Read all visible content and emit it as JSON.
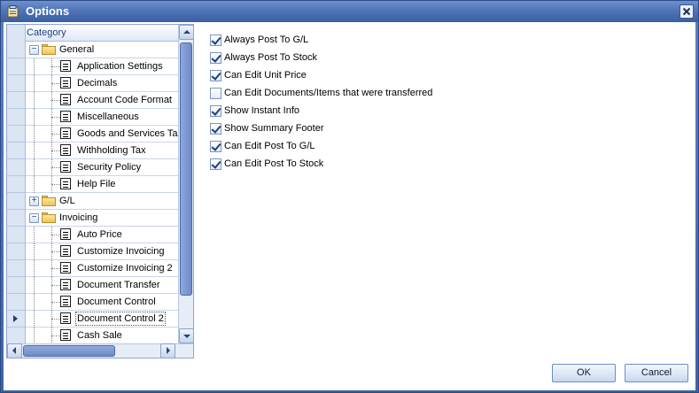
{
  "window": {
    "title": "Options"
  },
  "tree": {
    "header": "Category",
    "rows": [
      {
        "label": "General",
        "type": "folder",
        "expander": "−",
        "level": 0
      },
      {
        "label": "Application Settings",
        "type": "leaf",
        "level": 1
      },
      {
        "label": "Decimals",
        "type": "leaf",
        "level": 1
      },
      {
        "label": "Account Code Format",
        "type": "leaf",
        "level": 1
      },
      {
        "label": "Miscellaneous",
        "type": "leaf",
        "level": 1
      },
      {
        "label": "Goods and Services Tax",
        "type": "leaf",
        "level": 1
      },
      {
        "label": "Withholding Tax",
        "type": "leaf",
        "level": 1
      },
      {
        "label": "Security Policy",
        "type": "leaf",
        "level": 1
      },
      {
        "label": "Help File",
        "type": "leaf",
        "level": 1
      },
      {
        "label": "G/L",
        "type": "folder",
        "expander": "+",
        "level": 0
      },
      {
        "label": "Invoicing",
        "type": "folder",
        "expander": "−",
        "level": 0
      },
      {
        "label": "Auto Price",
        "type": "leaf",
        "level": 1
      },
      {
        "label": "Customize Invoicing",
        "type": "leaf",
        "level": 1
      },
      {
        "label": "Customize Invoicing 2",
        "type": "leaf",
        "level": 1
      },
      {
        "label": "Document Transfer",
        "type": "leaf",
        "level": 1
      },
      {
        "label": "Document Control",
        "type": "leaf",
        "level": 1
      },
      {
        "label": "Document Control 2",
        "type": "leaf",
        "level": 1,
        "selected": true
      },
      {
        "label": "Cash Sale",
        "type": "leaf",
        "level": 1
      }
    ]
  },
  "options": [
    {
      "label": "Always Post To G/L",
      "checked": true
    },
    {
      "label": "Always Post To Stock",
      "checked": true
    },
    {
      "label": "Can Edit Unit Price",
      "checked": true
    },
    {
      "label": "Can Edit Documents/Items that were transferred",
      "checked": false
    },
    {
      "label": "Show Instant Info",
      "checked": true
    },
    {
      "label": "Show Summary Footer",
      "checked": true
    },
    {
      "label": "Can Edit Post To G/L",
      "checked": true
    },
    {
      "label": "Can Edit Post To Stock",
      "checked": true
    }
  ],
  "buttons": {
    "ok": "OK",
    "cancel": "Cancel"
  },
  "colors": {
    "titlebar": "#4f74b7",
    "accent": "#1f3c78",
    "tree_border": "#8ca5cf"
  },
  "icons": {
    "close": "close-icon",
    "folder": "folder-icon",
    "leaf": "document-icon",
    "window": "options-window-icon"
  }
}
